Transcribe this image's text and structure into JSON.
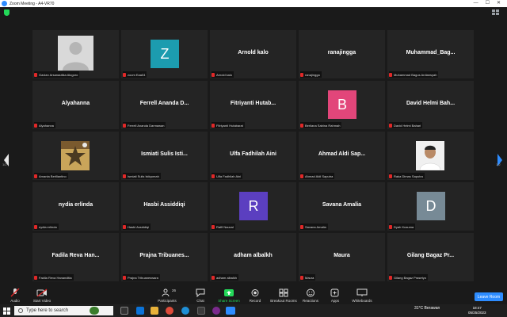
{
  "window": {
    "title": "Zoom Meeting - A4-VR70",
    "minimize": "—",
    "maximize": "☐",
    "close": "✕"
  },
  "pagination": {
    "left": "1/2",
    "right": "1/2"
  },
  "participants": [
    {
      "name": "",
      "label": "Gavian Arsanautika Alugoro",
      "avatar": "photo-placeholder"
    },
    {
      "name": "",
      "label": "zoom Eaa04",
      "avatar": "letter",
      "letter": "Z",
      "color": "#1c9caf"
    },
    {
      "name": "Arnold kalo",
      "label": "Arnold kalo"
    },
    {
      "name": "ranajingga",
      "label": "ranajingga"
    },
    {
      "name": "Muhammad_Bag...",
      "label": "Muhammad Bagus Ardiansyah"
    },
    {
      "name": "Alyahanna",
      "label": "Alyahanna"
    },
    {
      "name": "Ferrell Ananda D...",
      "label": "Ferrell Ananda Darmawan"
    },
    {
      "name": "Fitriyanti Hutab...",
      "label": "Fitriyanti Hutabarat"
    },
    {
      "name": "",
      "label": "Berliana Sabina Rahmah",
      "avatar": "letter",
      "letter": "B",
      "color": "#e2467a"
    },
    {
      "name": "David Helmi Bah...",
      "label": "David Helmi Bahari"
    },
    {
      "name": "",
      "label": "Amanta Berlliantino",
      "avatar": "photo-star"
    },
    {
      "name": "Ismiati Sulis Isti...",
      "label": "Ismiati Sulis Istiqomah"
    },
    {
      "name": "Ulfa Fadhilah Aini",
      "label": "Ulfa Fadhilah Aini"
    },
    {
      "name": "Ahmad Aldi Sap...",
      "label": "Ahmad Aldi Saputra"
    },
    {
      "name": "",
      "label": "Raka Dimas Saputra",
      "avatar": "photo-person"
    },
    {
      "name": "nydia erlinda",
      "label": "nydia erlinda"
    },
    {
      "name": "Hasbi Assiddiqi",
      "label": "Hasbi Assiddiqi"
    },
    {
      "name": "",
      "label": "Rafif Nauval",
      "avatar": "letter",
      "letter": "R",
      "color": "#5b3fc0"
    },
    {
      "name": "Savana Amalia",
      "label": "Savana Amalia"
    },
    {
      "name": "",
      "label": "Dyah Kusuma",
      "avatar": "letter",
      "letter": "D",
      "color": "#778a96"
    },
    {
      "name": "Fadila Reva Han...",
      "label": "Fadila Reva Hananditia"
    },
    {
      "name": "Prajna Tribuanes...",
      "label": "Prajna Tribuaneswara"
    },
    {
      "name": "adham albalkh",
      "label": "adham albalkh"
    },
    {
      "name": "Maura",
      "label": "Maura"
    },
    {
      "name": "Gilang Bagaz Pr...",
      "label": "Gilang Bagaz Prasetyo"
    }
  ],
  "toolbar": {
    "audio": "Audio",
    "video": "Start Video",
    "participants": "Participants",
    "participants_count": "26",
    "chat": "Chat",
    "share": "Share Screen",
    "record": "Record",
    "breakout": "Breakout Rooms",
    "reactions": "Reactions",
    "apps": "Apps",
    "whiteboards": "Whiteboards",
    "leave": "Leave Room"
  },
  "taskbar": {
    "search_placeholder": "Type here to search",
    "weather": "31°C  Berawan",
    "time": "18:47",
    "date": "05/25/2023"
  },
  "colors": {
    "accent": "#2d8cff",
    "share_green": "#23d959",
    "tile_bg": "#242424",
    "muted_red": "#e02828"
  }
}
